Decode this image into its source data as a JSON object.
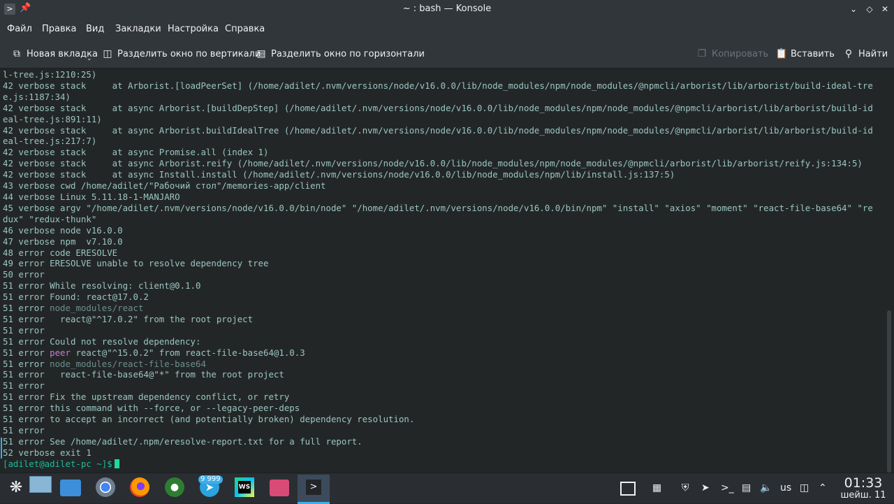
{
  "window": {
    "title": "~ : bash — Konsole",
    "app_icon": "terminal-icon",
    "pin_icon": "pin-icon",
    "controls": [
      "minimize-chevron-icon",
      "restore-diamond-icon",
      "close-x-icon"
    ]
  },
  "menu": [
    "Файл",
    "Правка",
    "Вид",
    "Закладки",
    "Настройка",
    "Справка"
  ],
  "toolbar": {
    "new_tab": "Новая вкладка",
    "split_vertical": "Разделить окно по вертикали",
    "split_horizontal": "Разделить окно по горизонтали",
    "copy": "Копировать",
    "paste": "Вставить",
    "find": "Найти"
  },
  "terminal": {
    "lines": [
      {
        "t": "l-tree.js:1210:25)"
      },
      {
        "t": "42 verbose stack     at Arborist.[loadPeerSet] (/home/adilet/.nvm/versions/node/v16.0.0/lib/node_modules/npm/node_modules/@npmcli/arborist/lib/arborist/build-ideal-tre"
      },
      {
        "t": "e.js:1187:34)"
      },
      {
        "t": "42 verbose stack     at async Arborist.[buildDepStep] (/home/adilet/.nvm/versions/node/v16.0.0/lib/node_modules/npm/node_modules/@npmcli/arborist/lib/arborist/build-id"
      },
      {
        "t": "eal-tree.js:891:11)"
      },
      {
        "t": "42 verbose stack     at async Arborist.buildIdealTree (/home/adilet/.nvm/versions/node/v16.0.0/lib/node_modules/npm/node_modules/@npmcli/arborist/lib/arborist/build-id"
      },
      {
        "t": "eal-tree.js:217:7)"
      },
      {
        "t": "42 verbose stack     at async Promise.all (index 1)"
      },
      {
        "t": "42 verbose stack     at async Arborist.reify (/home/adilet/.nvm/versions/node/v16.0.0/lib/node_modules/npm/node_modules/@npmcli/arborist/lib/arborist/reify.js:134:5)"
      },
      {
        "t": "42 verbose stack     at async Install.install (/home/adilet/.nvm/versions/node/v16.0.0/lib/node_modules/npm/lib/install.js:137:5)"
      },
      {
        "t": "43 verbose cwd /home/adilet/\"Рабочий стол\"/memories-app/client"
      },
      {
        "t": "44 verbose Linux 5.11.18-1-MANJARO"
      },
      {
        "t": "45 verbose argv \"/home/adilet/.nvm/versions/node/v16.0.0/bin/node\" \"/home/adilet/.nvm/versions/node/v16.0.0/bin/npm\" \"install\" \"axios\" \"moment\" \"react-file-base64\" \"re"
      },
      {
        "t": "dux\" \"redux-thunk\""
      },
      {
        "t": "46 verbose node v16.0.0"
      },
      {
        "t": "47 verbose npm  v7.10.0"
      },
      {
        "t": "48 error code ERESOLVE"
      },
      {
        "t": "49 error ERESOLVE unable to resolve dependency tree"
      },
      {
        "t": "50 error"
      },
      {
        "t": "51 error While resolving: client@0.1.0"
      },
      {
        "t": "51 error Found: react@17.0.2"
      },
      {
        "p": "51 error ",
        "d": "node_modules/react"
      },
      {
        "t": "51 error   react@\"^17.0.2\" from the root project"
      },
      {
        "t": "51 error"
      },
      {
        "t": "51 error Could not resolve dependency:"
      },
      {
        "p": "51 error ",
        "k": "peer",
        "r": " react@\"^15.0.2\" from react-file-base64@1.0.3"
      },
      {
        "p": "51 error ",
        "d": "node_modules/react-file-base64"
      },
      {
        "t": "51 error   react-file-base64@\"*\" from the root project"
      },
      {
        "t": "51 error"
      },
      {
        "t": "51 error Fix the upstream dependency conflict, or retry"
      },
      {
        "t": "51 error this command with --force, or --legacy-peer-deps"
      },
      {
        "t": "51 error to accept an incorrect (and potentially broken) dependency resolution."
      },
      {
        "t": "51 error"
      },
      {
        "t": "51 error See /home/adilet/.npm/eresolve-report.txt for a full report."
      },
      {
        "t": "52 verbose exit 1"
      }
    ],
    "prompt": "[adilet@adilet-pc ~]$"
  },
  "taskbar": {
    "apps": [
      "application-launcher-icon",
      "show-desktop-icon",
      "file-manager-icon",
      "chromium-icon",
      "firefox-icon",
      "green-app-icon",
      "telegram-icon",
      "webstorm-icon",
      "video-app-icon",
      "konsole-icon"
    ],
    "telegram_badge": "9 999",
    "webstorm_label": "WS",
    "keyboard_layout": "us",
    "time": "01:33",
    "date": "шейш. 11"
  },
  "colors": {
    "terminal_text": "#9ac6c2",
    "terminal_bg": "#232627",
    "peer_keyword": "#c77cd5",
    "prompt": "#1cbc9c",
    "accent": "#3daee9"
  }
}
